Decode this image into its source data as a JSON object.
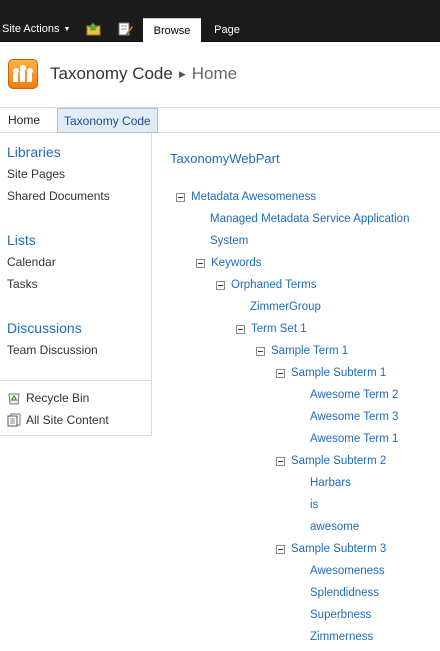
{
  "ribbon": {
    "site_actions": "Site Actions",
    "tabs": [
      "Browse",
      "Page"
    ]
  },
  "header": {
    "site_title": "Taxonomy Code",
    "current_page": "Home"
  },
  "topnav": {
    "items": [
      "Home",
      "Taxonomy Code"
    ]
  },
  "leftnav": {
    "libraries_heading": "Libraries",
    "libraries": [
      "Site Pages",
      "Shared Documents"
    ],
    "lists_heading": "Lists",
    "lists": [
      "Calendar",
      "Tasks"
    ],
    "discussions_heading": "Discussions",
    "discussions": [
      "Team Discussion"
    ],
    "recycle_bin": "Recycle Bin",
    "all_site_content": "All Site Content"
  },
  "webpart": {
    "title": "TaxonomyWebPart",
    "tree": [
      {
        "label": "Metadata Awesomeness",
        "expanded": true
      },
      {
        "label": "Managed Metadata Service Application"
      },
      {
        "label": "System"
      },
      {
        "label": "Keywords",
        "expanded": true
      },
      {
        "label": "Orphaned Terms",
        "expanded": true
      },
      {
        "label": "ZimmerGroup"
      },
      {
        "label": "Term Set 1",
        "expanded": true
      },
      {
        "label": "Sample Term 1",
        "expanded": true
      },
      {
        "label": "Sample Subterm 1",
        "expanded": true
      },
      {
        "label": "Awesome Term 2"
      },
      {
        "label": "Awesome Term 3"
      },
      {
        "label": "Awesome Term 1"
      },
      {
        "label": "Sample Subterm 2",
        "expanded": true
      },
      {
        "label": "Harbars"
      },
      {
        "label": "is"
      },
      {
        "label": "awesome"
      },
      {
        "label": "Sample Subterm 3",
        "expanded": true
      },
      {
        "label": "Awesomeness"
      },
      {
        "label": "Splendidness"
      },
      {
        "label": "Superbness"
      },
      {
        "label": "Zimmerness"
      }
    ]
  },
  "colors": {
    "ribbon_bg": "#1b1b1b",
    "link_blue": "#1f6bbd",
    "logo_orange": "#f07e10"
  }
}
